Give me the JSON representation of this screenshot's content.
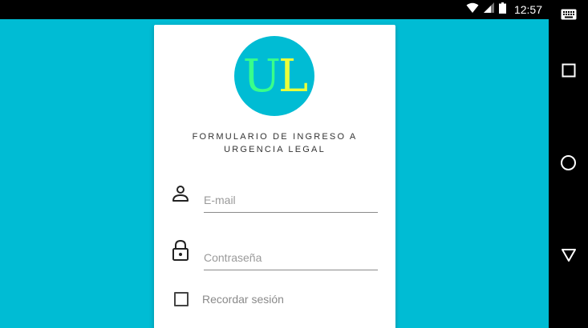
{
  "status_bar": {
    "time": "12:57",
    "icons": [
      "wifi-icon",
      "signal-icon",
      "battery-icon"
    ]
  },
  "nav_bar": {
    "buttons": [
      "keyboard-icon",
      "recents-icon",
      "home-icon",
      "back-icon"
    ]
  },
  "colors": {
    "background": "#00bcd4",
    "card": "#ffffff",
    "logo_u": "#39ff8a",
    "logo_l": "#eaff3a"
  },
  "logo": {
    "letter_u": "U",
    "letter_l": "L"
  },
  "form": {
    "title": "FORMULARIO DE INGRESO A URGENCIA LEGAL",
    "email_placeholder": "E-mail",
    "password_placeholder": "Contraseña",
    "remember_label": "Recordar sesión"
  }
}
